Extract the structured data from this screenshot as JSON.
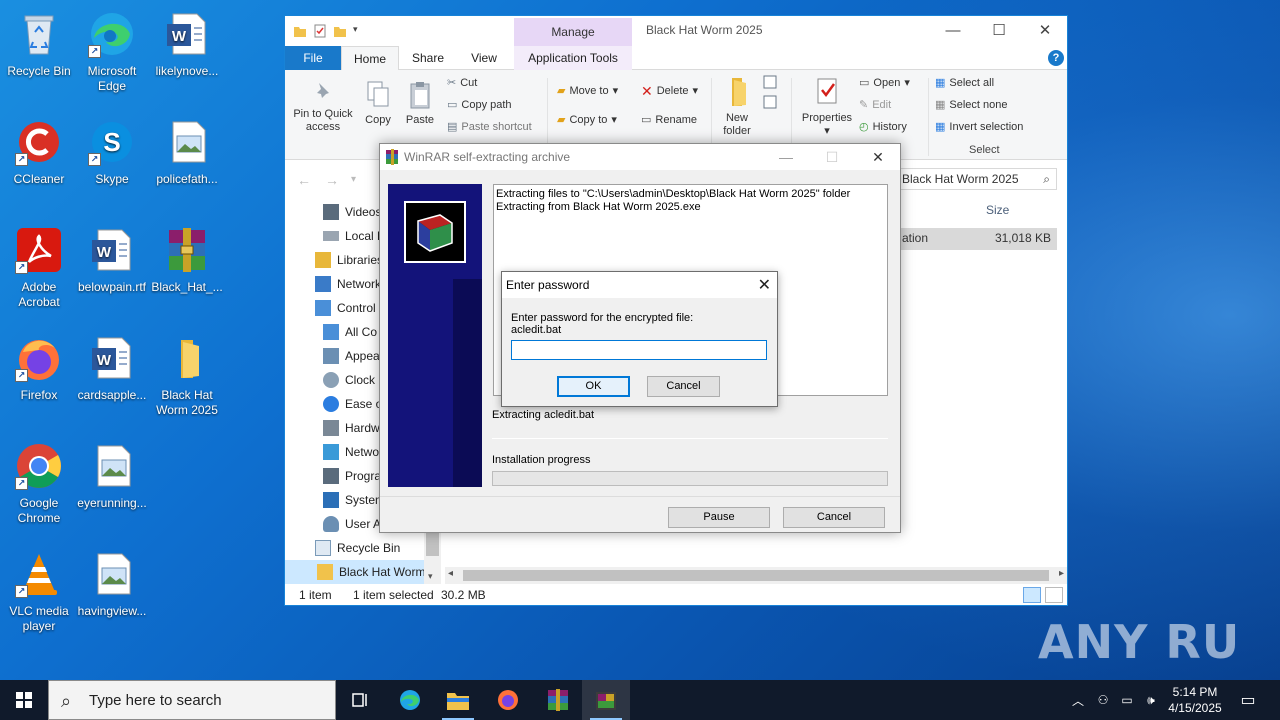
{
  "desktop": {
    "icons": [
      {
        "label": "Recycle Bin",
        "icon": "recycle-bin-icon"
      },
      {
        "label": "Microsoft Edge",
        "icon": "edge-icon"
      },
      {
        "label": "likelynove...",
        "icon": "word-document-icon"
      },
      {
        "label": "CCleaner",
        "icon": "ccleaner-icon"
      },
      {
        "label": "Skype",
        "icon": "skype-icon"
      },
      {
        "label": "policefath...",
        "icon": "image-file-icon"
      },
      {
        "label": "Adobe Acrobat",
        "icon": "acrobat-icon"
      },
      {
        "label": "belowpain.rtf",
        "icon": "word-document-icon"
      },
      {
        "label": "Black_Hat_...",
        "icon": "winrar-archive-icon"
      },
      {
        "label": "Firefox",
        "icon": "firefox-icon"
      },
      {
        "label": "cardsapple...",
        "icon": "word-document-icon"
      },
      {
        "label": "Black Hat Worm 2025",
        "icon": "folder-icon"
      },
      {
        "label": "Google Chrome",
        "icon": "chrome-icon"
      },
      {
        "label": "eyerunning...",
        "icon": "image-file-icon"
      },
      {
        "label": "VLC media player",
        "icon": "vlc-icon"
      },
      {
        "label": "havingview...",
        "icon": "image-file-icon"
      }
    ]
  },
  "explorer": {
    "title": "Black Hat Worm 2025",
    "manage_tab": "Manage",
    "tabs": {
      "file": "File",
      "home": "Home",
      "share": "Share",
      "view": "View",
      "app_tools": "Application Tools"
    },
    "ribbon": {
      "pin": "Pin to Quick access",
      "copy": "Copy",
      "paste": "Paste",
      "cut": "Cut",
      "copy_path": "Copy path",
      "paste_shortcut": "Paste shortcut",
      "move_to": "Move to",
      "copy_to": "Copy to",
      "delete": "Delete",
      "rename": "Rename",
      "new_folder": "New folder",
      "properties": "Properties",
      "open": "Open",
      "edit": "Edit",
      "history": "History",
      "select_all": "Select all",
      "select_none": "Select none",
      "invert_selection": "Invert selection",
      "select_group": "Select"
    },
    "search_placeholder": "Black Hat Worm 2025",
    "nav_items": [
      {
        "label": "Videos",
        "icon": "videos-icon"
      },
      {
        "label": "Local D",
        "icon": "drive-icon"
      },
      {
        "label": "Libraries",
        "icon": "libraries-icon"
      },
      {
        "label": "Network",
        "icon": "network-icon"
      },
      {
        "label": "Control",
        "icon": "control-panel-icon"
      },
      {
        "label": "All Co",
        "icon": "control-panel-icon"
      },
      {
        "label": "Appea",
        "icon": "appearance-icon"
      },
      {
        "label": "Clock",
        "icon": "clock-icon"
      },
      {
        "label": "Ease o",
        "icon": "ease-of-access-icon"
      },
      {
        "label": "Hardw",
        "icon": "hardware-icon"
      },
      {
        "label": "Netwo",
        "icon": "network-icon"
      },
      {
        "label": "Progra",
        "icon": "programs-icon"
      },
      {
        "label": "System",
        "icon": "system-icon"
      },
      {
        "label": "User A",
        "icon": "user-accounts-icon"
      },
      {
        "label": "Recycle Bin",
        "icon": "recycle-bin-icon"
      },
      {
        "label": "Black Hat Worm",
        "icon": "folder-icon"
      }
    ],
    "column_size": "Size",
    "file_row": {
      "type_fragment": "ation",
      "size": "31,018 KB"
    },
    "status": {
      "count": "1 item",
      "selected": "1 item selected",
      "size": "30.2 MB"
    }
  },
  "winrar": {
    "title": "WinRAR self-extracting archive",
    "log_lines": [
      "Extracting files to \"C:\\Users\\admin\\Desktop\\Black Hat Worm 2025\" folder",
      "Extracting from Black Hat Worm 2025.exe"
    ],
    "current": "Extracting acledit.bat",
    "progress_label": "Installation progress",
    "progress": 0,
    "pause": "Pause",
    "cancel": "Cancel"
  },
  "password_dialog": {
    "title": "Enter password",
    "prompt_line1": "Enter password for the encrypted file:",
    "prompt_line2": "acledit.bat",
    "value": "",
    "ok": "OK",
    "cancel": "Cancel"
  },
  "taskbar": {
    "search_placeholder": "Type here to search",
    "time": "5:14 PM",
    "date": "4/15/2025"
  },
  "watermark": "ANY RUN"
}
